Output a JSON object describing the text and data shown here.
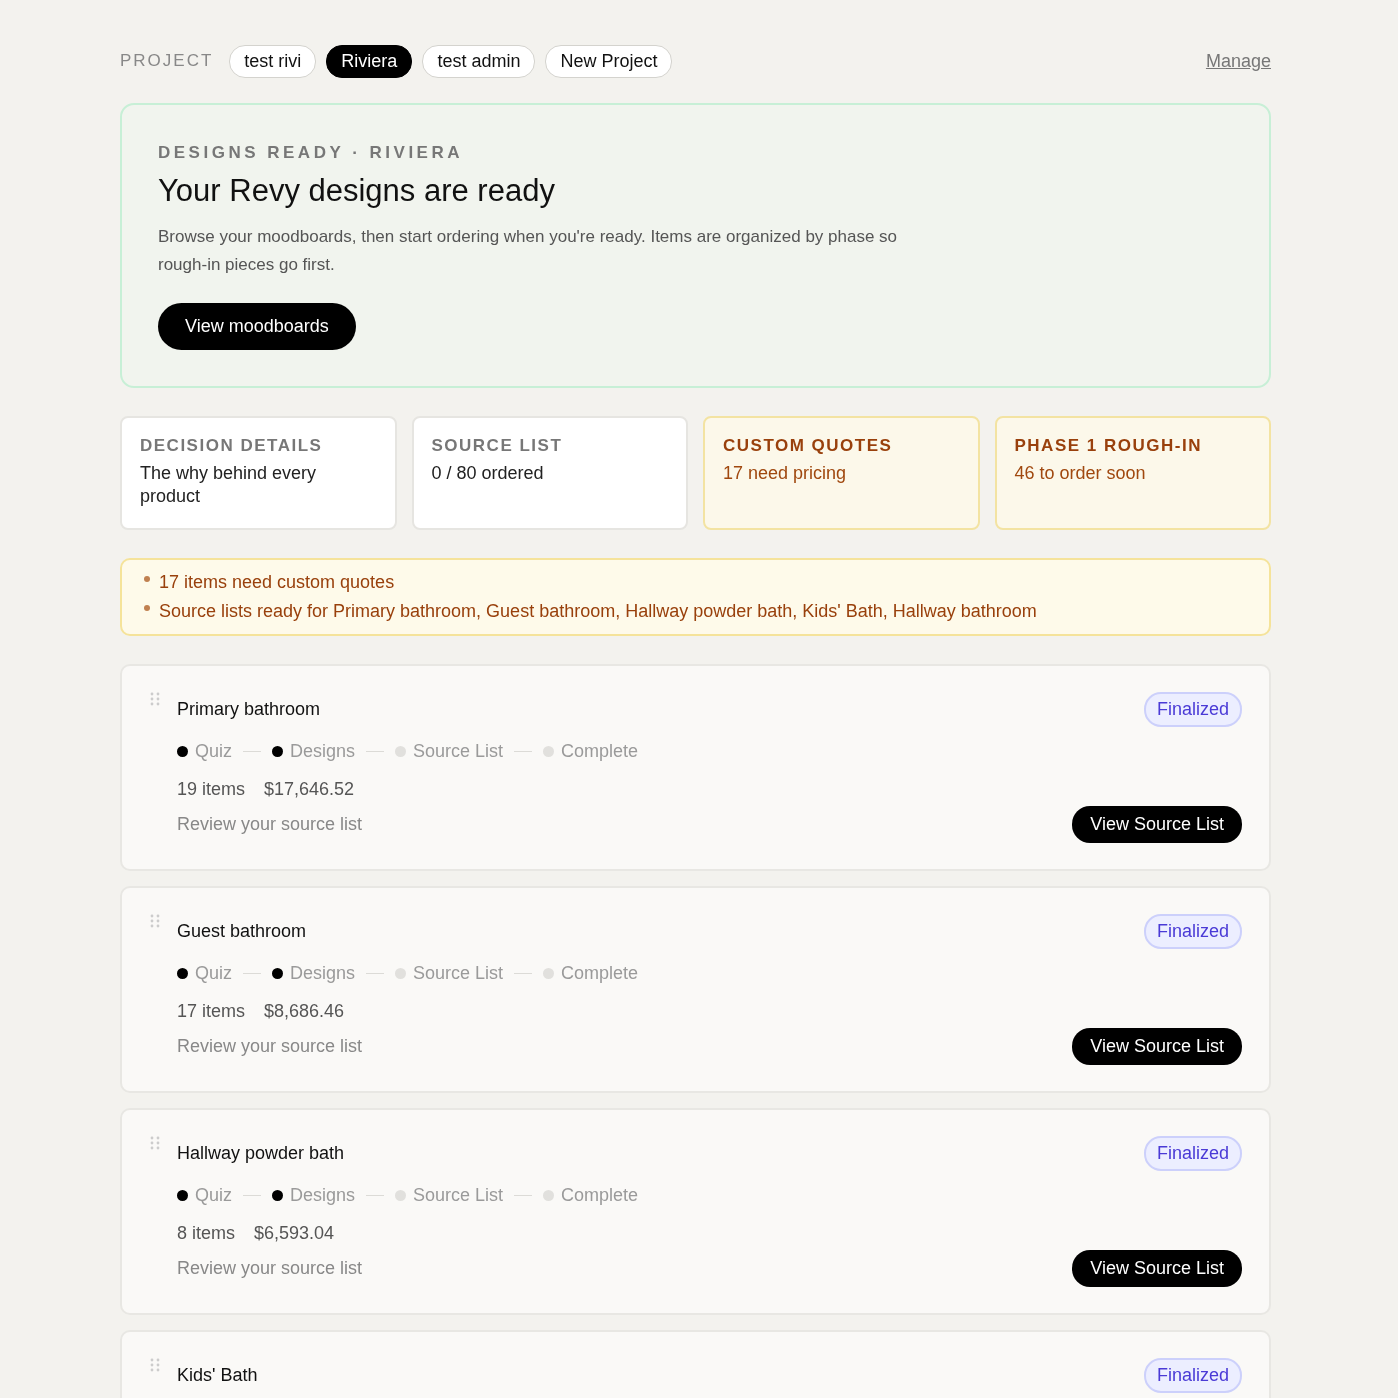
{
  "project_bar": {
    "label": "PROJECT",
    "projects": [
      {
        "name": "test rivi",
        "selected": false
      },
      {
        "name": "Riviera",
        "selected": true
      },
      {
        "name": "test admin",
        "selected": false
      },
      {
        "name": "New Project",
        "selected": false
      }
    ],
    "manage_link": "Manage"
  },
  "hero": {
    "eyebrow": "DESIGNS READY · RIVIERA",
    "title": "Your Revy designs are ready",
    "body": "Browse your moodboards, then start ordering when you're ready. Items are organized by phase so rough-in pieces go first.",
    "button": "View moodboards"
  },
  "tiles": [
    {
      "kind": "neutral",
      "title": "DECISION DETAILS",
      "text": "The why behind every product"
    },
    {
      "kind": "neutral",
      "title": "SOURCE LIST",
      "text": "0 / 80 ordered"
    },
    {
      "kind": "warning",
      "title": "CUSTOM QUOTES",
      "text": "17 need pricing"
    },
    {
      "kind": "warning",
      "title": "PHASE 1 ROUGH-IN",
      "text": "46 to order soon"
    }
  ],
  "notices": [
    "17 items need custom quotes",
    "Source lists ready for Primary bathroom, Guest bathroom, Hallway powder bath, Kids' Bath, Hallway bathroom"
  ],
  "rooms": [
    {
      "name": "Primary bathroom",
      "status": "Finalized",
      "steps": [
        {
          "label": "Quiz",
          "done": true
        },
        {
          "label": "Designs",
          "done": true
        },
        {
          "label": "Source List",
          "done": false
        },
        {
          "label": "Complete",
          "done": false
        }
      ],
      "items": "19 items",
      "total": "$17,646.52",
      "hint": "Review your source list",
      "button": "View Source List"
    },
    {
      "name": "Guest bathroom",
      "status": "Finalized",
      "steps": [
        {
          "label": "Quiz",
          "done": true
        },
        {
          "label": "Designs",
          "done": true
        },
        {
          "label": "Source List",
          "done": false
        },
        {
          "label": "Complete",
          "done": false
        }
      ],
      "items": "17 items",
      "total": "$8,686.46",
      "hint": "Review your source list",
      "button": "View Source List"
    },
    {
      "name": "Hallway powder bath",
      "status": "Finalized",
      "steps": [
        {
          "label": "Quiz",
          "done": true
        },
        {
          "label": "Designs",
          "done": true
        },
        {
          "label": "Source List",
          "done": false
        },
        {
          "label": "Complete",
          "done": false
        }
      ],
      "items": "8 items",
      "total": "$6,593.04",
      "hint": "Review your source list",
      "button": "View Source List"
    },
    {
      "name": "Kids' Bath",
      "status": "Finalized"
    }
  ]
}
